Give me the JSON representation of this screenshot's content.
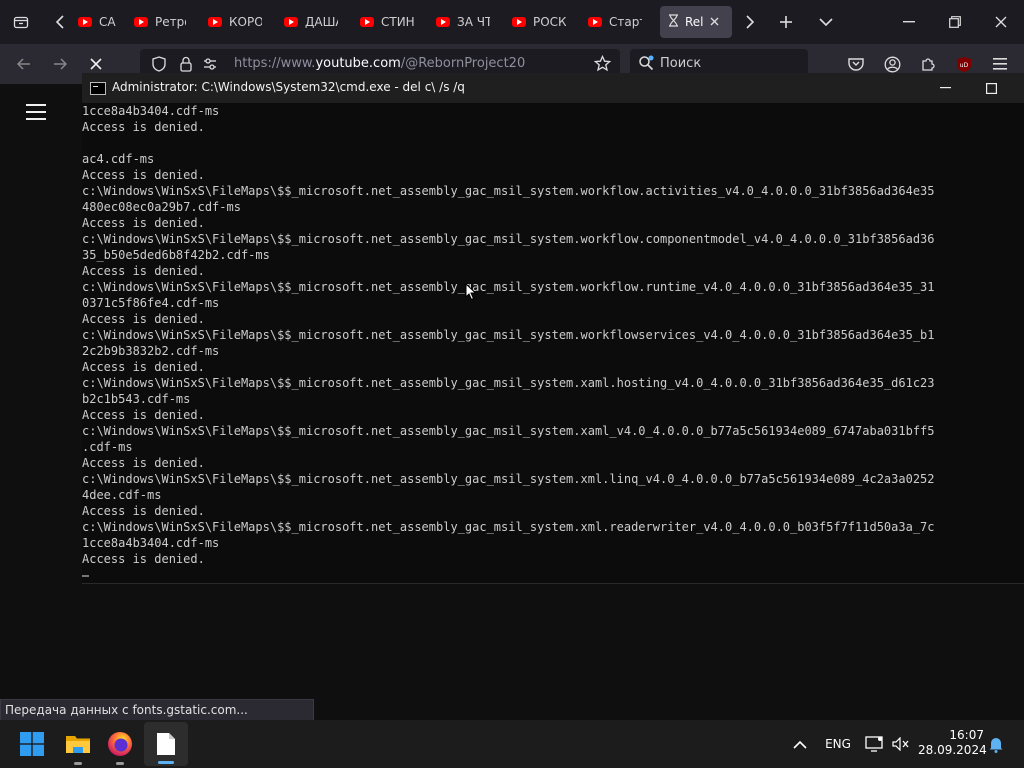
{
  "browser": {
    "tabs": [
      {
        "label": "САМЬ",
        "icon": "youtube-icon"
      },
      {
        "label": "Ретро",
        "icon": "youtube-icon"
      },
      {
        "label": "КОРО",
        "icon": "youtube-icon"
      },
      {
        "label": "ДАША",
        "icon": "youtube-icon"
      },
      {
        "label": "СТИН",
        "icon": "youtube-icon"
      },
      {
        "label": "ЗА ЧТ",
        "icon": "youtube-icon"
      },
      {
        "label": "РОСК",
        "icon": "youtube-icon"
      },
      {
        "label": "Старт",
        "icon": "youtube-icon"
      },
      {
        "label": "Rel",
        "icon": "hourglass-icon",
        "active": true
      }
    ],
    "url_prefix": "https://www.",
    "url_domain": "youtube.com",
    "url_path": "/@RebornProject20",
    "search_placeholder": "Поиск",
    "status_text": "Передача данных с fonts.gstatic.com..."
  },
  "cmd": {
    "title": "Administrator: C:\\Windows\\System32\\cmd.exe - del  c\\ /s /q",
    "lines": [
      "1cce8a4b3404.cdf-ms",
      "Access is denied.",
      "",
      "ac4.cdf-ms",
      "Access is denied.",
      "c:\\Windows\\WinSxS\\FileMaps\\$$_microsoft.net_assembly_gac_msil_system.workflow.activities_v4.0_4.0.0.0_31bf3856ad364e35",
      "480ec08ec0a29b7.cdf-ms",
      "Access is denied.",
      "c:\\Windows\\WinSxS\\FileMaps\\$$_microsoft.net_assembly_gac_msil_system.workflow.componentmodel_v4.0_4.0.0.0_31bf3856ad36",
      "35_b50e5ded6b8f42b2.cdf-ms",
      "Access is denied.",
      "c:\\Windows\\WinSxS\\FileMaps\\$$_microsoft.net_assembly_gac_msil_system.workflow.runtime_v4.0_4.0.0.0_31bf3856ad364e35_31",
      "0371c5f86fe4.cdf-ms",
      "Access is denied.",
      "c:\\Windows\\WinSxS\\FileMaps\\$$_microsoft.net_assembly_gac_msil_system.workflowservices_v4.0_4.0.0.0_31bf3856ad364e35_b1",
      "2c2b9b3832b2.cdf-ms",
      "Access is denied.",
      "c:\\Windows\\WinSxS\\FileMaps\\$$_microsoft.net_assembly_gac_msil_system.xaml.hosting_v4.0_4.0.0.0_31bf3856ad364e35_d61c23",
      "b2c1b543.cdf-ms",
      "Access is denied.",
      "c:\\Windows\\WinSxS\\FileMaps\\$$_microsoft.net_assembly_gac_msil_system.xaml_v4.0_4.0.0.0_b77a5c561934e089_6747aba031bff5",
      ".cdf-ms",
      "Access is denied.",
      "c:\\Windows\\WinSxS\\FileMaps\\$$_microsoft.net_assembly_gac_msil_system.xml.linq_v4.0_4.0.0.0_b77a5c561934e089_4c2a3a0252",
      "4dee.cdf-ms",
      "Access is denied.",
      "c:\\Windows\\WinSxS\\FileMaps\\$$_microsoft.net_assembly_gac_msil_system.xml.readerwriter_v4.0_4.0.0.0_b03f5f7f11d50a3a_7c",
      "1cce8a4b3404.cdf-ms",
      "Access is denied."
    ]
  },
  "taskbar": {
    "language": "ENG",
    "time": "16:07",
    "date": "28.09.2024"
  },
  "colors": {
    "tabstrip_bg": "#1c1b22",
    "navbar_bg": "#2b2a33",
    "cmd_bg": "#0c0c0c",
    "cmd_text": "#cccccc",
    "taskbar_bg": "#1c1c1c",
    "youtube_red": "#ff0000"
  }
}
